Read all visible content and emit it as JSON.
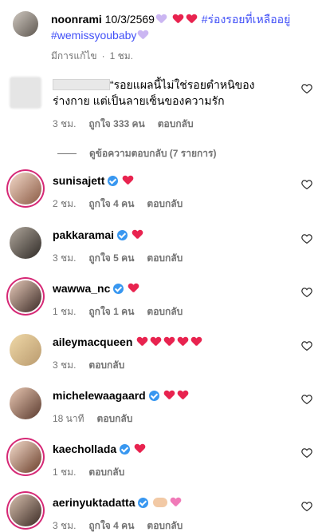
{
  "caption": {
    "username": "noonrami",
    "date_text": "10/3/2569",
    "hashtag1": "#ร่องรอยที่เหลืออยู่",
    "hashtag2": "#wemissyoubaby",
    "meta_edited": "มีการแก้ไข",
    "meta_time": "1 ชม."
  },
  "top_comment": {
    "text": "“รอยแผลนี้ไม่ใช่รอยตำหนิของร่างกาย แต่เป็นลายเซ็นของความรัก",
    "time": "3 ชม.",
    "likes": "ถูกใจ 333 คน",
    "reply": "ตอบกลับ"
  },
  "view_replies": "ดูข้อความตอบกลับ (7 รายการ)",
  "comments": [
    {
      "username": "sunisajett",
      "time": "2 ชม.",
      "likes": "ถูกใจ 4 คน",
      "reply": "ตอบกลับ"
    },
    {
      "username": "pakkaramai",
      "time": "3 ชม.",
      "likes": "ถูกใจ 5 คน",
      "reply": "ตอบกลับ"
    },
    {
      "username": "wawwa_nc",
      "time": "1 ชม.",
      "likes": "ถูกใจ 1 คน",
      "reply": "ตอบกลับ"
    },
    {
      "username": "aileymacqueen",
      "time": "3 ชม.",
      "likes": "",
      "reply": "ตอบกลับ"
    },
    {
      "username": "michelewaagaard",
      "time": "18 นาที",
      "likes": "",
      "reply": "ตอบกลับ"
    },
    {
      "username": "kaecholLada",
      "time": "1 ชม.",
      "likes": "",
      "reply": "ตอบกลับ"
    },
    {
      "username": "aerinyuktadatta",
      "time": "3 ชม.",
      "likes": "ถูกใจ 4 คน",
      "reply": "ตอบกลับ"
    }
  ],
  "colors": {
    "heart": "#e8234f",
    "link": "#4150f7",
    "meta": "#737373",
    "ring": "#d62976",
    "verified": "#3897f0"
  }
}
